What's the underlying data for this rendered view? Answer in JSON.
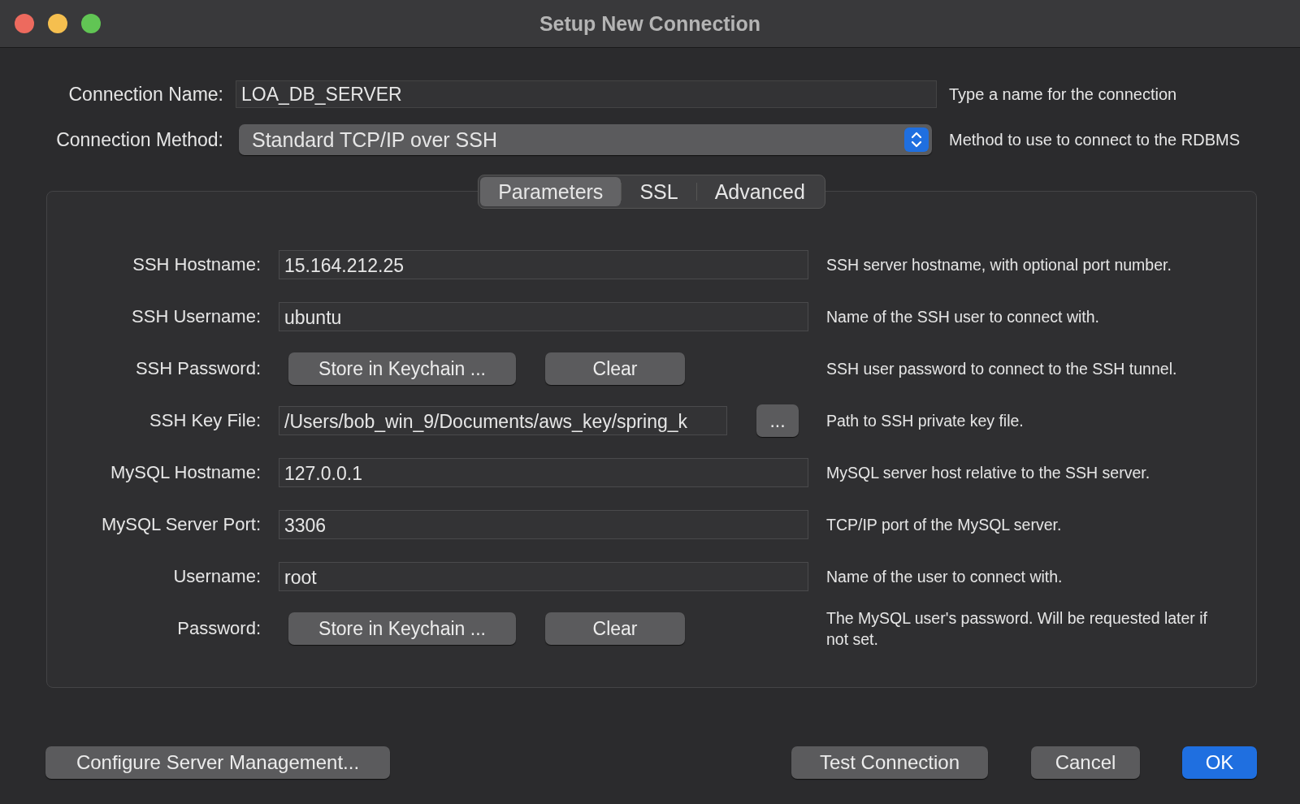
{
  "window": {
    "title": "Setup New Connection"
  },
  "connection_name": {
    "label": "Connection Name:",
    "value": "LOA_DB_SERVER",
    "hint": "Type a name for the connection"
  },
  "connection_method": {
    "label": "Connection Method:",
    "value": "Standard TCP/IP over SSH",
    "hint": "Method to use to connect to the RDBMS"
  },
  "tabs": [
    {
      "label": "Parameters",
      "selected": true
    },
    {
      "label": "SSL",
      "selected": false
    },
    {
      "label": "Advanced",
      "selected": false
    }
  ],
  "parameters": [
    {
      "kind": "text",
      "label": "SSH Hostname:",
      "value": "15.164.212.25",
      "hint": "SSH server hostname, with  optional port number."
    },
    {
      "kind": "text",
      "label": "SSH Username:",
      "value": "ubuntu",
      "hint": "Name of the SSH user to connect with."
    },
    {
      "kind": "keychain",
      "label": "SSH Password:",
      "store": "Store in Keychain ...",
      "clear": "Clear",
      "hint": "SSH user password to connect to the SSH tunnel."
    },
    {
      "kind": "file",
      "label": "SSH Key File:",
      "value": "/Users/bob_win_9/Documents/aws_key/spring_k",
      "browse": "...",
      "hint": "Path to SSH private key file."
    },
    {
      "kind": "text",
      "label": "MySQL Hostname:",
      "value": "127.0.0.1",
      "hint": "MySQL server host relative to the SSH server."
    },
    {
      "kind": "text",
      "label": "MySQL Server Port:",
      "value": "3306",
      "hint": "TCP/IP port of the MySQL server."
    },
    {
      "kind": "text",
      "label": "Username:",
      "value": "root",
      "hint": "Name of the user to connect with."
    },
    {
      "kind": "keychain",
      "label": "Password:",
      "store": "Store in Keychain ...",
      "clear": "Clear",
      "hint": "The MySQL user's password. Will be requested later if not set."
    }
  ],
  "buttons": {
    "configure": "Configure Server Management...",
    "test": "Test Connection",
    "cancel": "Cancel",
    "ok": "OK"
  }
}
